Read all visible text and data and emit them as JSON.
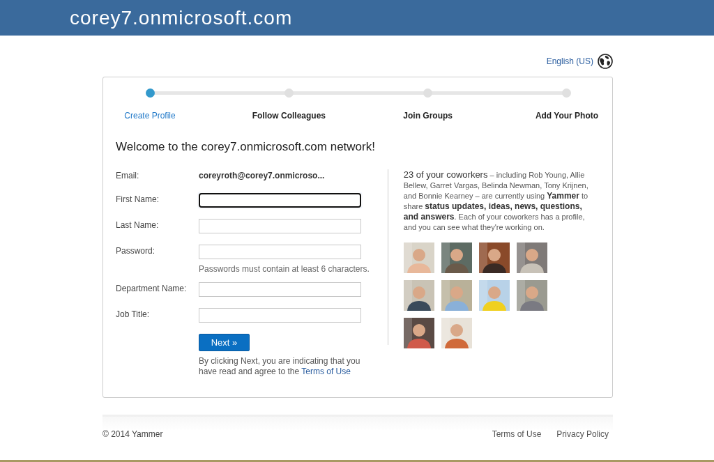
{
  "header": {
    "title": "corey7.onmicrosoft.com"
  },
  "language": {
    "label": "English (US)"
  },
  "steps": [
    {
      "label": "Create Profile",
      "selected": true
    },
    {
      "label": "Follow Colleagues",
      "selected": false
    },
    {
      "label": "Join Groups",
      "selected": false
    },
    {
      "label": "Add Your Photo",
      "selected": false
    }
  ],
  "heading": "Welcome to the corey7.onmicrosoft.com network!",
  "email": {
    "label": "Email:",
    "value": "coreyroth@corey7.onmicroso..."
  },
  "fields": [
    {
      "label": "First Name:",
      "focused": true
    },
    {
      "label": "Last Name:",
      "focused": false
    },
    {
      "label": "Password:",
      "focused": false,
      "hint": "Passwords must contain at least 6 characters."
    },
    {
      "label": "Department Name:",
      "focused": false
    },
    {
      "label": "Job Title:",
      "focused": false
    }
  ],
  "next_button": "Next »",
  "agreement": {
    "text": "By clicking Next, you are indicating that you have read and agree to the",
    "link": "Terms of Use"
  },
  "coworkers": {
    "lead": "23 of your coworkers",
    "text": " – including Rob Young, Allie Bellew, Garret Vargas, Belinda Newman, Tony Krijnen, and Bonnie Kearney – are currently using **Yammer** to share **status updates, ideas, news, questions, and answers**. Each of your coworkers has a profile, and you can see what they're working on."
  },
  "footer": {
    "copyright": "© 2014 Yammer",
    "links": [
      "Terms of Use",
      "Privacy Policy"
    ]
  }
}
